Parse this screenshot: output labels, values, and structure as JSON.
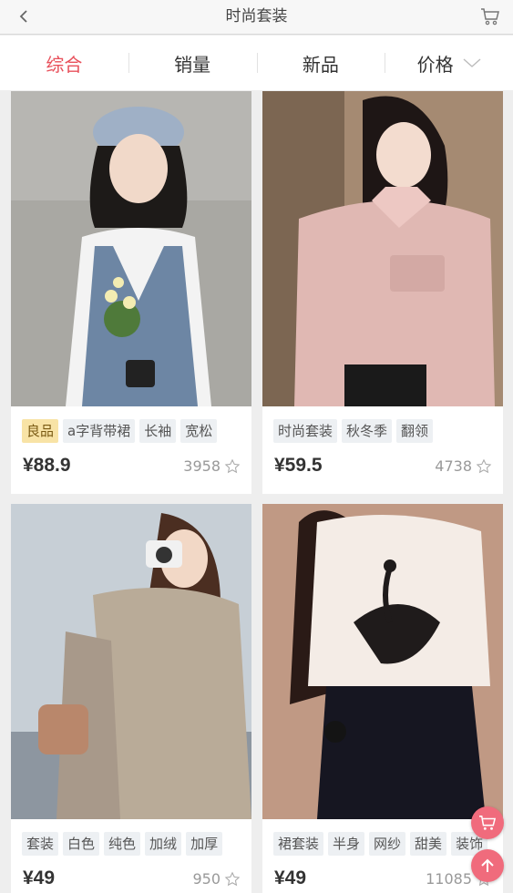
{
  "header": {
    "title": "时尚套装",
    "back_icon": "chevron-left-icon",
    "cart_icon": "cart-icon"
  },
  "sort_tabs": [
    {
      "label": "综合",
      "active": true
    },
    {
      "label": "销量",
      "active": false
    },
    {
      "label": "新品",
      "active": false
    },
    {
      "label": "价格",
      "active": false
    }
  ],
  "colors": {
    "accent": "#e8505b",
    "highlight_tag_bg": "#f8e3a6",
    "tag_bg": "#edf0f3",
    "fab": "#f06b7c"
  },
  "products": [
    {
      "tags": [
        "良品",
        "a字背带裙",
        "长袖",
        "宽松"
      ],
      "highlight_first_tag": true,
      "price": "¥88.9",
      "likes": "3958"
    },
    {
      "tags": [
        "时尚套装",
        "秋冬季",
        "翻领"
      ],
      "highlight_first_tag": false,
      "price": "¥59.5",
      "likes": "4738"
    },
    {
      "tags": [
        "套装",
        "白色",
        "纯色",
        "加绒",
        "加厚"
      ],
      "highlight_first_tag": false,
      "price": "¥49",
      "likes": "950"
    },
    {
      "tags": [
        "裙套装",
        "半身",
        "网纱",
        "甜美",
        "装饰"
      ],
      "highlight_first_tag": false,
      "price": "¥49",
      "likes": "11085"
    }
  ],
  "floating_buttons": {
    "cart_icon": "cart-icon",
    "top_icon": "arrow-up-icon"
  }
}
